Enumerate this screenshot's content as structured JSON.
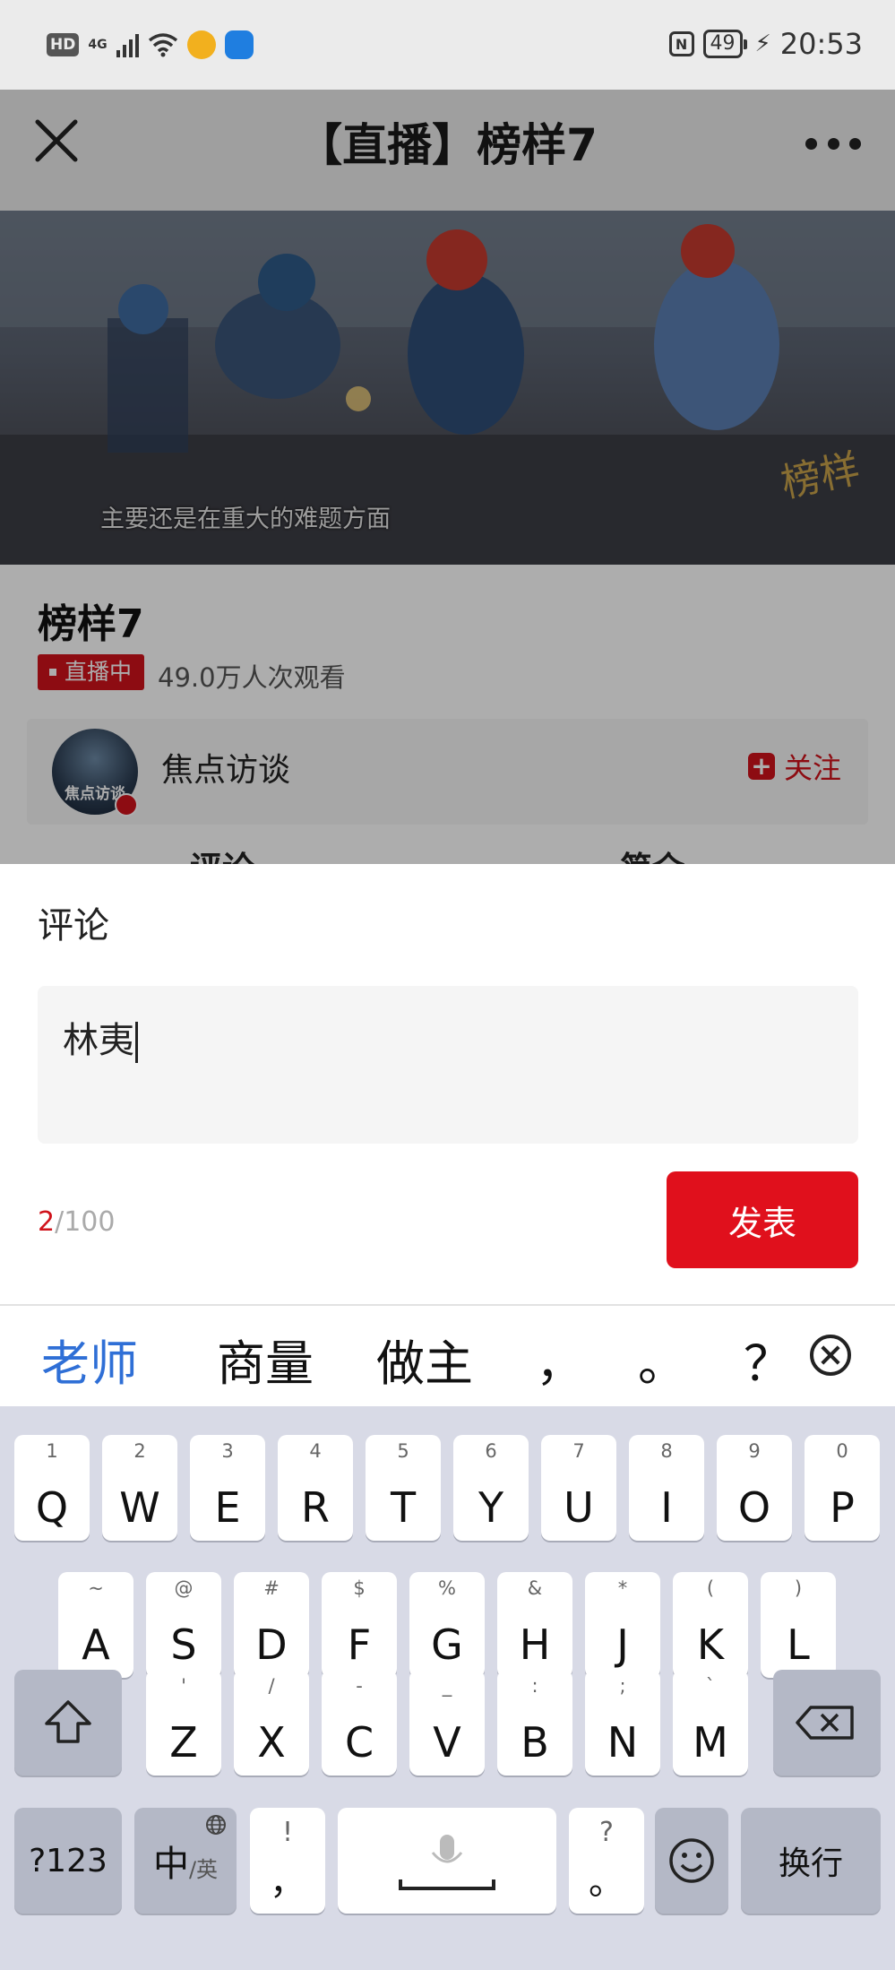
{
  "status_bar": {
    "hd": "HD",
    "network": "4G",
    "battery": "49",
    "time": "20:53"
  },
  "nav": {
    "title": "【直播】榜样7"
  },
  "video": {
    "subtitle": "主要还是在重大的难题方面",
    "watermark": "榜样"
  },
  "program": {
    "title": "榜样7",
    "live_badge": "直播中",
    "views": "49.0万人次观看"
  },
  "author": {
    "avatar_text": "焦点访谈",
    "name": "焦点访谈",
    "follow_label": "关注"
  },
  "tabs": [
    "评论",
    "简介"
  ],
  "comment_sheet": {
    "title": "评论",
    "input_value": "林夷",
    "count_current": "2",
    "count_max": "/100",
    "publish_label": "发表"
  },
  "candidates": [
    "老师",
    "商量",
    "做主",
    "，",
    "。",
    "？"
  ],
  "keyboard": {
    "row1": [
      {
        "pri": "Q",
        "sec": "1"
      },
      {
        "pri": "W",
        "sec": "2"
      },
      {
        "pri": "E",
        "sec": "3"
      },
      {
        "pri": "R",
        "sec": "4"
      },
      {
        "pri": "T",
        "sec": "5"
      },
      {
        "pri": "Y",
        "sec": "6"
      },
      {
        "pri": "U",
        "sec": "7"
      },
      {
        "pri": "I",
        "sec": "8"
      },
      {
        "pri": "O",
        "sec": "9"
      },
      {
        "pri": "P",
        "sec": "0"
      }
    ],
    "row2": [
      {
        "pri": "A",
        "sec": "~"
      },
      {
        "pri": "S",
        "sec": "@"
      },
      {
        "pri": "D",
        "sec": "#"
      },
      {
        "pri": "F",
        "sec": "$"
      },
      {
        "pri": "G",
        "sec": "%"
      },
      {
        "pri": "H",
        "sec": "&"
      },
      {
        "pri": "J",
        "sec": "*"
      },
      {
        "pri": "K",
        "sec": "("
      },
      {
        "pri": "L",
        "sec": ")"
      }
    ],
    "row3": [
      {
        "pri": "Z",
        "sec": "'"
      },
      {
        "pri": "X",
        "sec": "/"
      },
      {
        "pri": "C",
        "sec": "-"
      },
      {
        "pri": "V",
        "sec": "_"
      },
      {
        "pri": "B",
        "sec": ":"
      },
      {
        "pri": "N",
        "sec": ";"
      },
      {
        "pri": "M",
        "sec": "`"
      }
    ],
    "num_label": "?123",
    "lang_main": "中",
    "lang_sub": "/英",
    "comma": {
      "pri": "，",
      "sec": "!"
    },
    "period": {
      "pri": "。",
      "sec": "?"
    },
    "enter_label": "换行"
  }
}
